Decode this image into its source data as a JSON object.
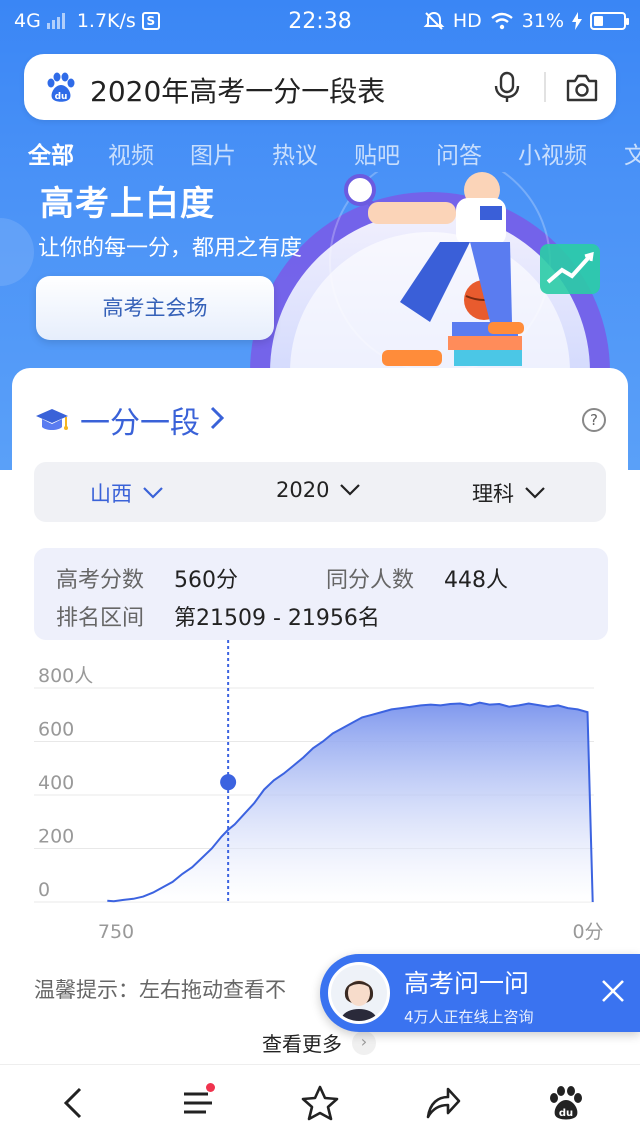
{
  "status_bar": {
    "network": "4G",
    "speed": "1.7K/s",
    "s_icon_label": "S",
    "time": "22:38",
    "hd": "HD",
    "battery": "31%",
    "battery_level": 0.31
  },
  "search": {
    "query": "2020年高考一分一段表"
  },
  "tabs": [
    "全部",
    "视频",
    "图片",
    "热议",
    "贴吧",
    "问答",
    "小视频",
    "文"
  ],
  "banner": {
    "title": "高考上白度",
    "subtitle": "让你的每一分，都用之有度",
    "button": "高考主会场"
  },
  "card": {
    "title": "一分一段",
    "help": "?",
    "selects": {
      "province": "山西",
      "year": "2020",
      "subject": "理科"
    },
    "info": {
      "score_label": "高考分数",
      "score_value": "560分",
      "same_label": "同分人数",
      "same_value": "448人",
      "rank_label": "排名区间",
      "rank_value": "第21509 - 21956名"
    },
    "tip": "温馨提示：左右拖动查看不",
    "more": "查看更多",
    "more_icon": "›"
  },
  "chart_data": {
    "type": "area",
    "y_ticks": [
      "800人",
      "600",
      "400",
      "200",
      "0"
    ],
    "ylim": [
      0,
      800
    ],
    "x_labels": [
      "750",
      "0分"
    ],
    "xlim": [
      750,
      0
    ],
    "marker": {
      "x": 560,
      "y": 448
    },
    "x": [
      745,
      735,
      720,
      705,
      690,
      675,
      660,
      645,
      630,
      615,
      600,
      585,
      570,
      560,
      550,
      535,
      520,
      505,
      490,
      475,
      460,
      445,
      430,
      415,
      400,
      385,
      370,
      355,
      340,
      325,
      310,
      295,
      280,
      265,
      250,
      235,
      220,
      205,
      190,
      175,
      160,
      145,
      130,
      115,
      100,
      85,
      70,
      55,
      40,
      25,
      10,
      2
    ],
    "y": [
      5,
      3,
      8,
      12,
      20,
      35,
      55,
      75,
      105,
      130,
      165,
      200,
      245,
      270,
      290,
      330,
      370,
      420,
      455,
      480,
      510,
      540,
      575,
      600,
      630,
      650,
      670,
      690,
      700,
      710,
      720,
      725,
      730,
      735,
      738,
      735,
      740,
      742,
      735,
      745,
      738,
      740,
      730,
      735,
      742,
      736,
      730,
      735,
      725,
      720,
      710,
      0
    ],
    "colors": {
      "line": "#3c63e0",
      "fill_top": "#7f98ee",
      "fill_bottom": "#ffffff",
      "grid": "#e8e8e8",
      "marker": "#3c63e0"
    }
  },
  "consult": {
    "title": "高考问一问",
    "subtitle": "4万人正在线上咨询"
  },
  "colors": {
    "accent": "#3a62d8",
    "header_blue": "#3a86f5",
    "consult_blue": "#3a73f0"
  },
  "bottom_nav": [
    "back-icon",
    "menu-icon",
    "star-icon",
    "share-icon",
    "baidu-icon"
  ]
}
